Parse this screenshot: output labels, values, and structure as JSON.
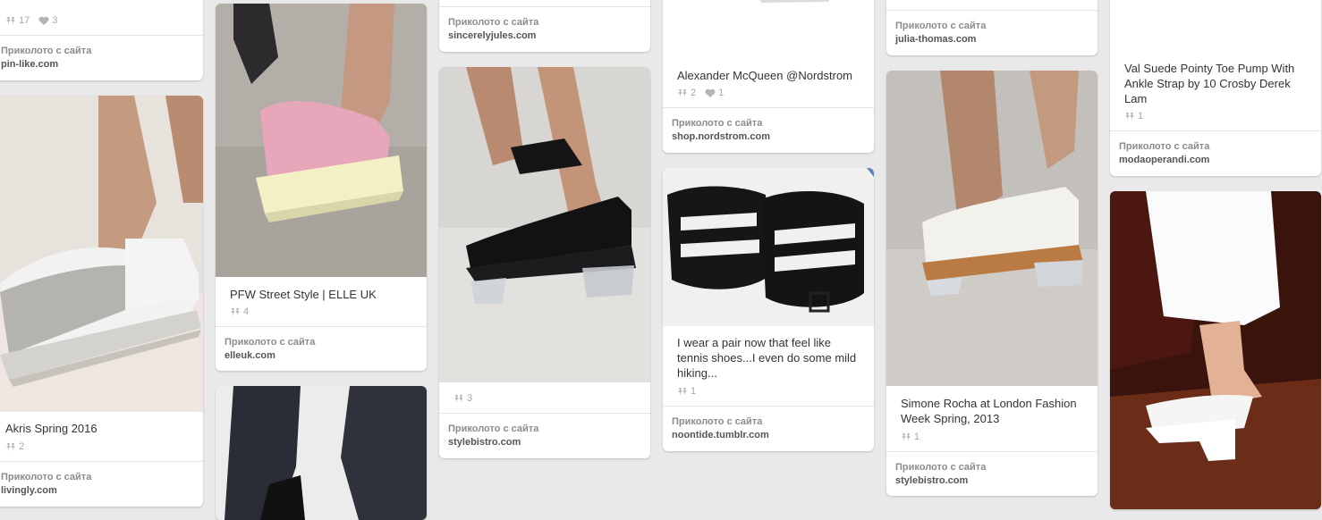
{
  "colors": {
    "background": "#e9e9e9",
    "card": "#ffffff",
    "muted": "#a7a7a7"
  },
  "pins": [
    {
      "id": "c1a",
      "title": "",
      "repins": "17",
      "likes": "3",
      "source_label": "Приколото с сайта",
      "source_site": "pin-like.com"
    },
    {
      "id": "c1b",
      "title": "Akris Spring 2016",
      "repins": "2",
      "likes": "",
      "source_label": "Приколото с сайта",
      "source_site": "livingly.com"
    },
    {
      "id": "c2a",
      "title": "PFW Street Style | ELLE UK",
      "repins": "4",
      "likes": "",
      "source_label": "Приколото с сайта",
      "source_site": "elleuk.com"
    },
    {
      "id": "c3a",
      "title": "",
      "repins": "",
      "likes": "",
      "source_label": "Приколото с сайта",
      "source_site": "sincerelyjules.com"
    },
    {
      "id": "c3b",
      "title": "",
      "repins": "3",
      "likes": "",
      "source_label": "Приколото с сайта",
      "source_site": "stylebistro.com"
    },
    {
      "id": "c4a",
      "title": "Alexander McQueen @Nordstrom",
      "repins": "2",
      "likes": "1",
      "source_label": "Приколото с сайта",
      "source_site": "shop.nordstrom.com"
    },
    {
      "id": "c4b",
      "title": "I wear a pair now that feel like tennis shoes...I even do some mild hiking...",
      "repins": "1",
      "likes": "",
      "source_label": "Приколото с сайта",
      "source_site": "noontide.tumblr.com"
    },
    {
      "id": "c5a",
      "title": "",
      "repins": "",
      "likes": "",
      "source_label": "Приколото с сайта",
      "source_site": "julia-thomas.com"
    },
    {
      "id": "c5b",
      "title": "Simone Rocha at London Fashion Week Spring, 2013",
      "repins": "1",
      "likes": "",
      "source_label": "Приколото с сайта",
      "source_site": "stylebistro.com"
    },
    {
      "id": "c6a",
      "title": "Val Suede Pointy Toe Pump With Ankle Strap by 10 Crosby Derek Lam",
      "repins": "1",
      "likes": "",
      "source_label": "Приколото с сайта",
      "source_site": "modaoperandi.com"
    }
  ]
}
